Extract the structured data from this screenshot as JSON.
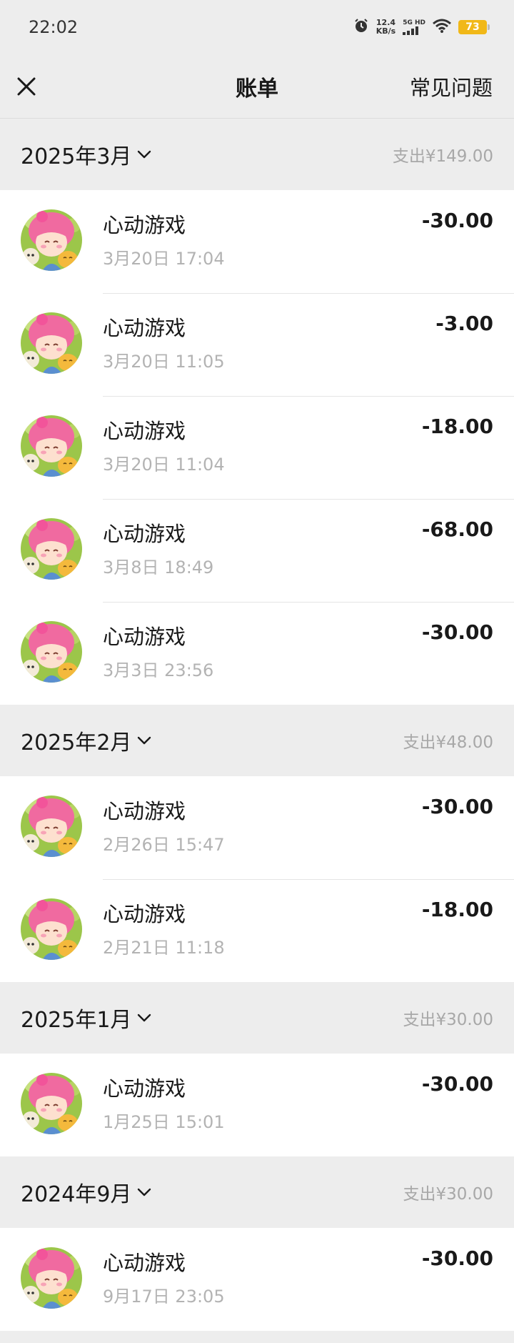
{
  "status_bar": {
    "time": "22:02",
    "speed_value": "12.4",
    "speed_unit": "KB/s",
    "network": "5G HD",
    "battery": "73"
  },
  "nav": {
    "title": "账单",
    "faq_label": "常见问题",
    "close_icon": "close-icon"
  },
  "months": [
    {
      "label": "2025年3月",
      "total": "支出¥149.00",
      "transactions": [
        {
          "name": "心动游戏",
          "time": "3月20日 17:04",
          "amount": "-30.00"
        },
        {
          "name": "心动游戏",
          "time": "3月20日 11:05",
          "amount": "-3.00"
        },
        {
          "name": "心动游戏",
          "time": "3月20日 11:04",
          "amount": "-18.00"
        },
        {
          "name": "心动游戏",
          "time": "3月8日 18:49",
          "amount": "-68.00"
        },
        {
          "name": "心动游戏",
          "time": "3月3日 23:56",
          "amount": "-30.00"
        }
      ]
    },
    {
      "label": "2025年2月",
      "total": "支出¥48.00",
      "transactions": [
        {
          "name": "心动游戏",
          "time": "2月26日 15:47",
          "amount": "-30.00"
        },
        {
          "name": "心动游戏",
          "time": "2月21日 11:18",
          "amount": "-18.00"
        }
      ]
    },
    {
      "label": "2025年1月",
      "total": "支出¥30.00",
      "transactions": [
        {
          "name": "心动游戏",
          "time": "1月25日 15:01",
          "amount": "-30.00"
        }
      ]
    },
    {
      "label": "2024年9月",
      "total": "支出¥30.00",
      "transactions": [
        {
          "name": "心动游戏",
          "time": "9月17日 23:05",
          "amount": "-30.00"
        }
      ]
    }
  ]
}
